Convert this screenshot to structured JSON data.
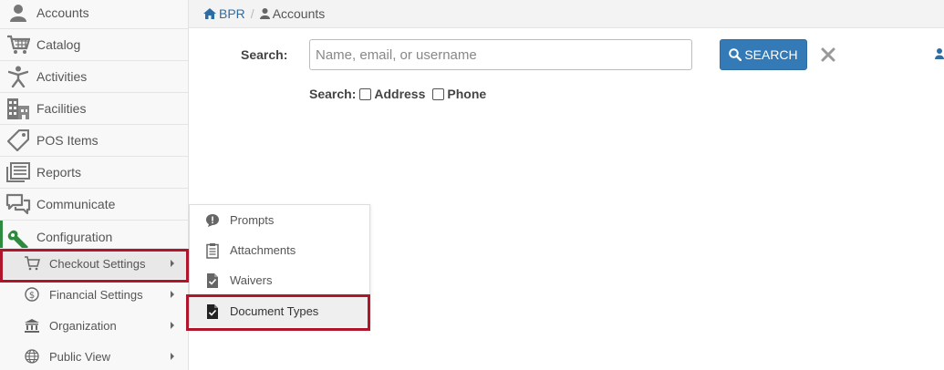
{
  "breadcrumb": {
    "home": "BPR",
    "separator": "/",
    "current": "Accounts"
  },
  "search": {
    "label": "Search:",
    "placeholder": "Name, email, or username",
    "value": "",
    "button_label": "SEARCH",
    "options_label": "Search:",
    "option_address": "Address",
    "option_phone": "Phone"
  },
  "sidebar": {
    "items": [
      {
        "label": "Accounts",
        "icon": "user-icon"
      },
      {
        "label": "Catalog",
        "icon": "cart-icon"
      },
      {
        "label": "Activities",
        "icon": "person-icon"
      },
      {
        "label": "Facilities",
        "icon": "building-icon"
      },
      {
        "label": "POS Items",
        "icon": "tag-icon"
      },
      {
        "label": "Reports",
        "icon": "reports-icon"
      },
      {
        "label": "Communicate",
        "icon": "chat-icon"
      },
      {
        "label": "Configuration",
        "icon": "wrench-icon"
      }
    ],
    "config_sub": [
      {
        "label": "Checkout Settings",
        "icon": "cart-icon"
      },
      {
        "label": "Financial Settings",
        "icon": "dollar-icon"
      },
      {
        "label": "Organization",
        "icon": "bank-icon"
      },
      {
        "label": "Public View",
        "icon": "globe-icon"
      }
    ]
  },
  "flyout": {
    "items": [
      {
        "label": "Prompts",
        "icon": "speech-alert-icon"
      },
      {
        "label": "Attachments",
        "icon": "clipboard-icon"
      },
      {
        "label": "Waivers",
        "icon": "file-check-icon"
      },
      {
        "label": "Document Types",
        "icon": "file-check-dark-icon"
      }
    ]
  },
  "colors": {
    "primary": "#337ab7",
    "link": "#2e6da4",
    "highlight_border": "#b0162b",
    "active_accent": "#2d8a3e",
    "wrench_green": "#2d8a3e"
  }
}
